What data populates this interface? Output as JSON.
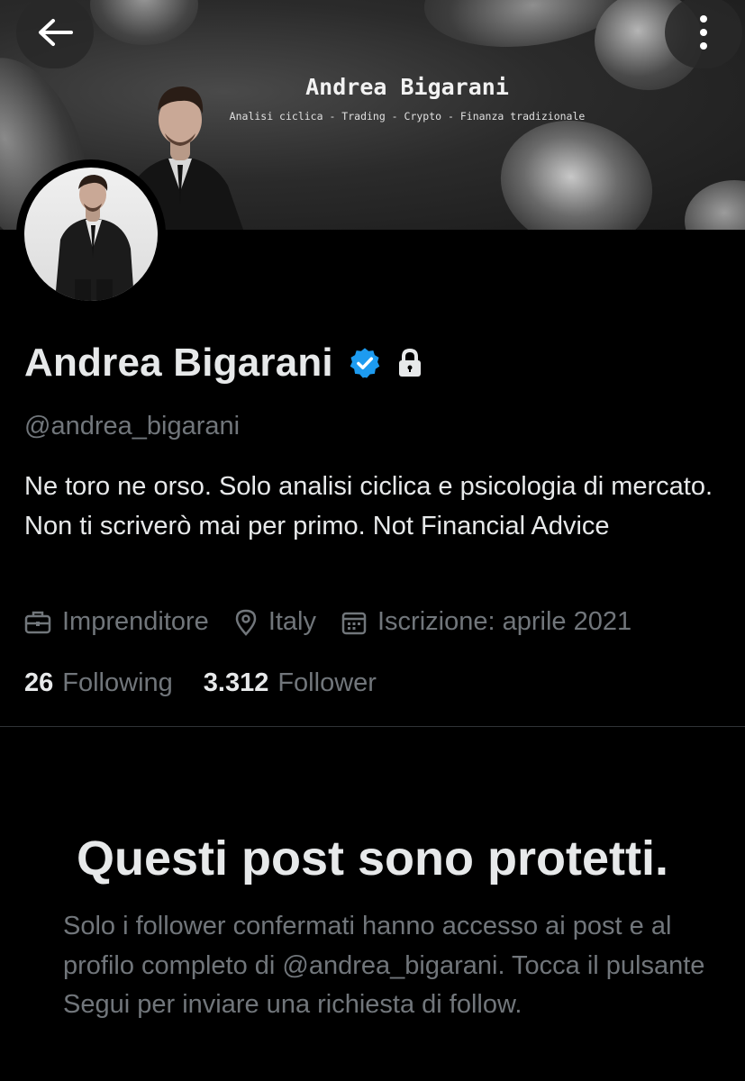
{
  "banner": {
    "title": "Andrea Bigarani",
    "subtitle": "Analisi ciclica - Trading - Crypto - Finanza tradizionale"
  },
  "nav": {
    "back_icon": "arrow-left-icon",
    "more_icon": "more-vertical-icon"
  },
  "profile": {
    "name": "Andrea Bigarani",
    "handle": "@andrea_bigarani",
    "bio": "Ne toro ne orso. Solo analisi ciclica e psicologia di mercato. Non ti scriverò mai per primo. Not Financial Advice",
    "verified_color": "#1d9bf0",
    "meta": {
      "profession": "Imprenditore",
      "location": "Italy",
      "joined": "Iscrizione: aprile 2021"
    },
    "stats": {
      "following_count": "26",
      "following_label": "Following",
      "followers_count": "3.312",
      "followers_label": "Follower"
    }
  },
  "protected": {
    "title": "Questi post sono protetti.",
    "message": "Solo i follower confermati hanno accesso ai post e al profilo completo di @andrea_bigarani. Tocca il pulsante Segui per inviare una richiesta di follow."
  },
  "colors": {
    "background": "#000000",
    "primary_text": "#e7e9ea",
    "secondary_text": "#71767b",
    "accent": "#1d9bf0"
  }
}
